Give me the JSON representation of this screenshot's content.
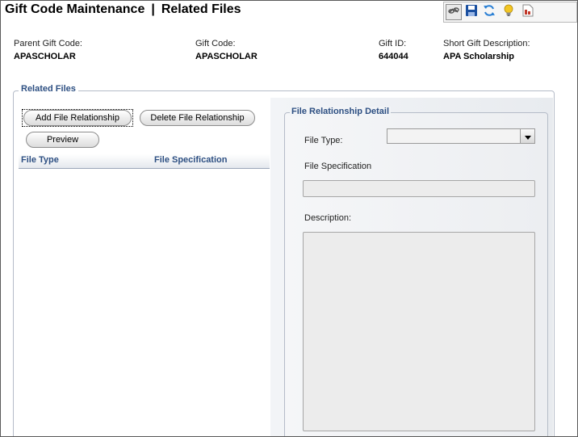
{
  "header": {
    "title_main": "Gift Code Maintenance",
    "title_separator": "|",
    "title_sub": "Related Files"
  },
  "toolbar": {
    "buttons": [
      {
        "name": "link-icon",
        "color": "#555555"
      },
      {
        "name": "save-icon",
        "color": "#1a4fa0"
      },
      {
        "name": "refresh-icon",
        "color": "#2a7fd4"
      },
      {
        "name": "lightbulb-icon",
        "color": "#f0c020"
      },
      {
        "name": "report-icon",
        "color": "#c0392b"
      }
    ]
  },
  "info": {
    "parent_gift_code_label": "Parent Gift Code:",
    "parent_gift_code_value": "APASCHOLAR",
    "gift_code_label": "Gift Code:",
    "gift_code_value": "APASCHOLAR",
    "gift_id_label": "Gift ID:",
    "gift_id_value": "644044",
    "short_desc_label": "Short Gift Description:",
    "short_desc_value": "APA Scholarship"
  },
  "related_files": {
    "legend": "Related Files",
    "add_button": "Add File Relationship",
    "delete_button": "Delete File Relationship",
    "preview_button": "Preview",
    "columns": [
      "File Type",
      "File Specification"
    ],
    "rows": []
  },
  "detail": {
    "legend": "File Relationship Detail",
    "file_type_label": "File Type:",
    "file_type_value": "",
    "file_spec_label": "File Specification",
    "file_spec_value": "",
    "description_label": "Description:",
    "description_value": ""
  },
  "colors": {
    "accent": "#2d4f82",
    "border": "#b5bcc8"
  }
}
